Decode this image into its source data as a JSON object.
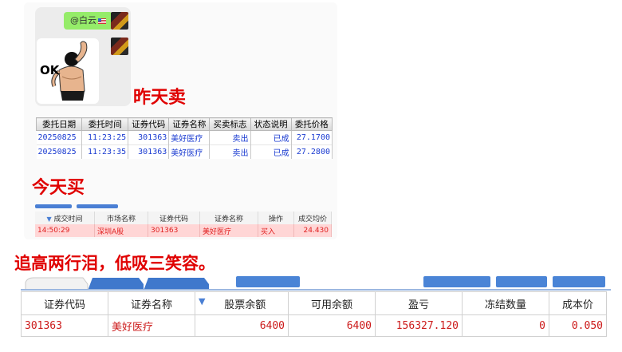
{
  "chat": {
    "mention": "@白云"
  },
  "sticker": {
    "text": "OK"
  },
  "captions": {
    "yesterday": "昨天卖",
    "today": "今天买",
    "slogan": "追高两行泪，低吸三笑容。"
  },
  "order_table": {
    "headers": [
      "委托日期",
      "委托时间",
      "证券代码",
      "证券名称",
      "买卖标志",
      "状态说明",
      "委托价格"
    ],
    "rows": [
      [
        "20250825",
        "11:23:25",
        "301363",
        "美好医疗",
        "卖出",
        "已成",
        "27.1700"
      ],
      [
        "20250825",
        "11:23:35",
        "301363",
        "美好医疗",
        "卖出",
        "已成",
        "27.2800"
      ]
    ]
  },
  "trade_table": {
    "headers": [
      "成交时间",
      "市场名称",
      "证券代码",
      "证券名称",
      "操作",
      "成交均价"
    ],
    "rows": [
      [
        "14:50:29",
        "深圳A股",
        "301363",
        "美好医疗",
        "买入",
        "24.430"
      ]
    ]
  },
  "position_table": {
    "headers": [
      "证券代码",
      "证券名称",
      "股票余额",
      "可用余额",
      "盈亏",
      "冻结数量",
      "成本价"
    ],
    "rows": [
      [
        "301363",
        "美好医疗",
        "6400",
        "6400",
        "156327.120",
        "0",
        "0.050"
      ]
    ]
  },
  "colors": {
    "caption": "#e00000",
    "bubble": "#95ec69",
    "sell_text": "#1a3bd1",
    "buy_row_bg": "#ffd6d6",
    "buy_text": "#e02020",
    "position_text": "#cc1a1a",
    "tab_blue": "#4a7fd4"
  }
}
